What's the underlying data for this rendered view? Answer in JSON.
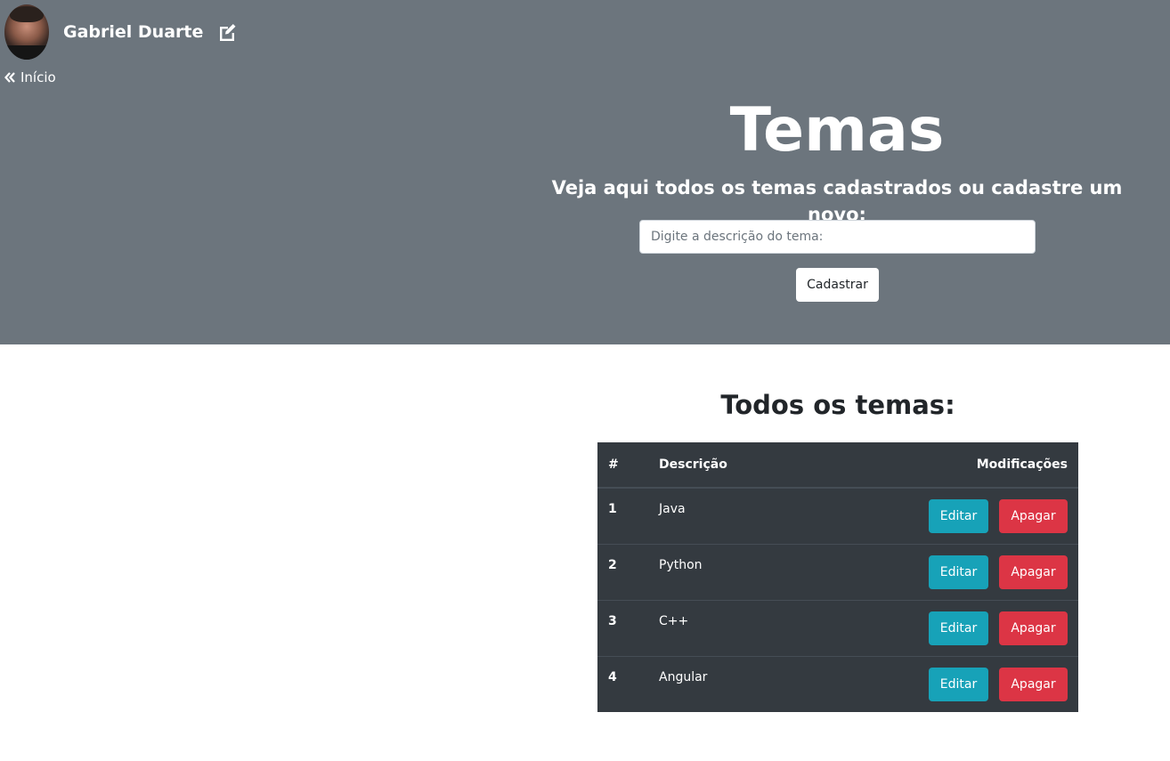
{
  "user": {
    "name": "Gabriel Duarte"
  },
  "nav": {
    "back_label": "Início"
  },
  "page": {
    "title": "Temas",
    "subtitle": "Veja aqui todos os temas cadastrados ou cadastre um novo:",
    "input_placeholder": "Digite a descrição do tema:",
    "input_value": "",
    "submit_label": "Cadastrar"
  },
  "list": {
    "title": "Todos os temas:",
    "columns": [
      "#",
      "Descrição",
      "Modificações"
    ],
    "rows": [
      {
        "id": "1",
        "description": "Java",
        "edit_label": "Editar",
        "delete_label": "Apagar"
      },
      {
        "id": "2",
        "description": "Python",
        "edit_label": "Editar",
        "delete_label": "Apagar"
      },
      {
        "id": "3",
        "description": "C++",
        "edit_label": "Editar",
        "delete_label": "Apagar"
      },
      {
        "id": "4",
        "description": "Angular",
        "edit_label": "Editar",
        "delete_label": "Apagar"
      }
    ]
  },
  "colors": {
    "header_bg": "#6c757d",
    "table_bg": "#343a40",
    "edit_button": "#17a2b8",
    "delete_button": "#dc3545"
  },
  "icons": {
    "edit": "edit-icon",
    "back": "angle-double-left-icon"
  }
}
